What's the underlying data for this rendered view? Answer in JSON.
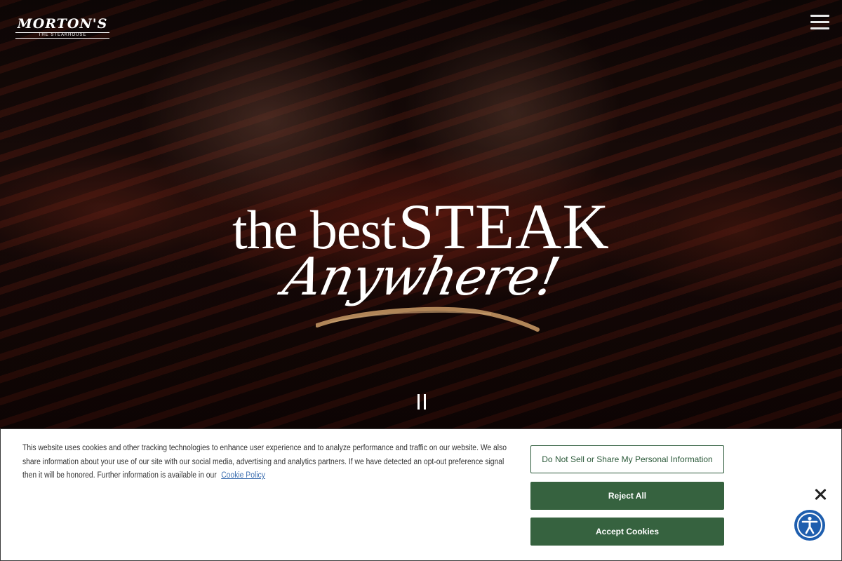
{
  "brand": {
    "name": "MORTON'S",
    "tagline": "THE STEAKHOUSE"
  },
  "nav": {
    "menu_icon": "hamburger-menu-icon"
  },
  "hero": {
    "headline_small": "the best",
    "headline_big": "STEAK",
    "headline_script": "Anywhere!",
    "pause_icon": "pause-icon"
  },
  "cookie_banner": {
    "text": "This website uses cookies and other tracking technologies to enhance user experience and to analyze performance and traffic on our website. We also share information about your use of our site with our social media, advertising and analytics partners. If we have detected an opt-out preference signal then it will be honored. Further information is available in our",
    "policy_link": "Cookie Policy",
    "do_not_sell_label": "Do Not Sell or Share My Personal Information",
    "reject_label": "Reject All",
    "accept_label": "Accept Cookies",
    "close_icon": "close-icon"
  },
  "accessibility": {
    "icon": "accessibility-icon"
  },
  "colors": {
    "button_green": "#36623f",
    "link_blue": "#3d6fb0",
    "accessibility_blue": "#1e5eae",
    "brush_gold": "#b08558"
  }
}
